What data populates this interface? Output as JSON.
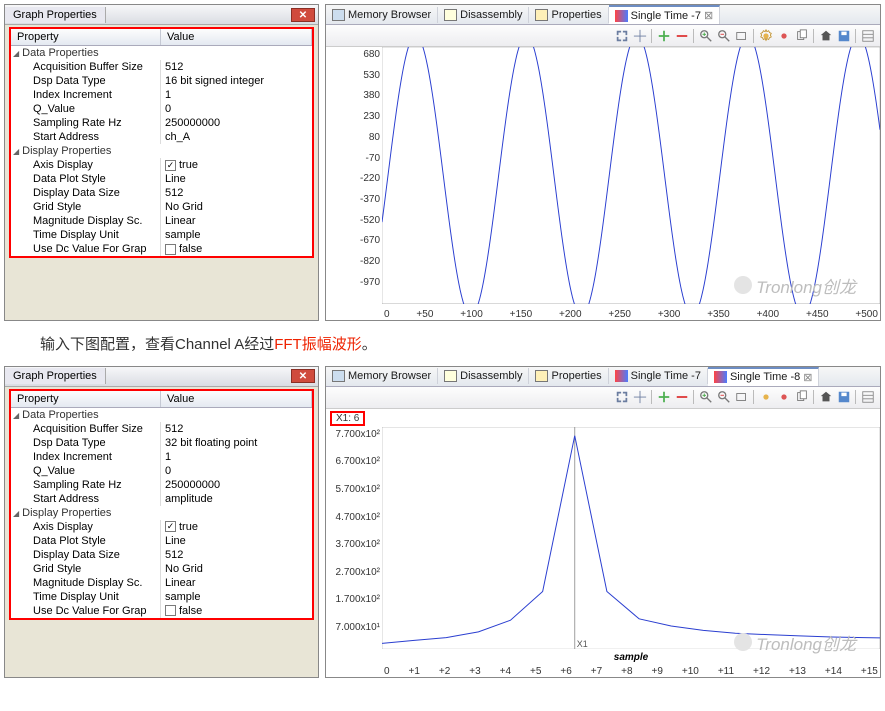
{
  "top_panel": {
    "window_title": "Graph Properties",
    "header": {
      "prop": "Property",
      "val": "Value"
    },
    "cat1": "Data Properties",
    "props1": [
      {
        "name": "Acquisition Buffer Size",
        "value": "512"
      },
      {
        "name": "Dsp Data Type",
        "value": "16 bit signed integer"
      },
      {
        "name": "Index Increment",
        "value": "1"
      },
      {
        "name": "Q_Value",
        "value": "0"
      },
      {
        "name": "Sampling Rate Hz",
        "value": "250000000"
      },
      {
        "name": "Start Address",
        "value": "ch_A"
      }
    ],
    "cat2": "Display Properties",
    "props2": [
      {
        "name": "Axis Display",
        "value": "true",
        "checkbox": true,
        "checked": true
      },
      {
        "name": "Data Plot Style",
        "value": "Line"
      },
      {
        "name": "Display Data Size",
        "value": "512"
      },
      {
        "name": "Grid Style",
        "value": "No Grid"
      },
      {
        "name": "Magnitude Display Sc.",
        "value": "Linear"
      },
      {
        "name": "Time Display Unit",
        "value": "sample"
      },
      {
        "name": "Use Dc Value For Grap",
        "value": "false",
        "checkbox": true,
        "checked": false
      }
    ]
  },
  "top_tabs": {
    "tabs": [
      {
        "label": "Memory Browser",
        "icon": "ico-mem"
      },
      {
        "label": "Disassembly",
        "icon": "ico-dis"
      },
      {
        "label": "Properties",
        "icon": "ico-prop"
      },
      {
        "label": "Single Time -7",
        "icon": "ico-chart",
        "active": true
      }
    ]
  },
  "bottom_tabs": {
    "tabs": [
      {
        "label": "Memory Browser",
        "icon": "ico-mem"
      },
      {
        "label": "Disassembly",
        "icon": "ico-dis"
      },
      {
        "label": "Properties",
        "icon": "ico-prop"
      },
      {
        "label": "Single Time -7",
        "icon": "ico-chart"
      },
      {
        "label": "Single Time -8",
        "icon": "ico-chart",
        "active": true
      }
    ]
  },
  "caption_pre": "输入下图配置，查看Channel A经过",
  "caption_hl": "FFT振幅波形",
  "caption_post": "。",
  "bottom_panel": {
    "window_title": "Graph Properties",
    "header": {
      "prop": "Property",
      "val": "Value"
    },
    "cat1": "Data Properties",
    "props1": [
      {
        "name": "Acquisition Buffer Size",
        "value": "512"
      },
      {
        "name": "Dsp Data Type",
        "value": "32 bit floating point"
      },
      {
        "name": "Index Increment",
        "value": "1"
      },
      {
        "name": "Q_Value",
        "value": "0"
      },
      {
        "name": "Sampling Rate Hz",
        "value": "250000000"
      },
      {
        "name": "Start Address",
        "value": "amplitude"
      }
    ],
    "cat2": "Display Properties",
    "props2": [
      {
        "name": "Axis Display",
        "value": "true",
        "checkbox": true,
        "checked": true
      },
      {
        "name": "Data Plot Style",
        "value": "Line"
      },
      {
        "name": "Display Data Size",
        "value": "512"
      },
      {
        "name": "Grid Style",
        "value": "No Grid"
      },
      {
        "name": "Magnitude Display Sc.",
        "value": "Linear"
      },
      {
        "name": "Time Display Unit",
        "value": "sample"
      },
      {
        "name": "Use Dc Value For Grap",
        "value": "false",
        "checkbox": true,
        "checked": false
      }
    ]
  },
  "bottom_marker": "X1: 6",
  "bottom_marker_label": "X1",
  "bottom_xlabel": "sample",
  "watermark": "Tronlong创龙",
  "chart_data": [
    {
      "type": "line",
      "title": "Single Time -7",
      "xlabel": "",
      "ylabel": "",
      "xlim": [
        0,
        510
      ],
      "ylim": [
        -970,
        680
      ],
      "x_ticks": [
        "0",
        "+50",
        "+100",
        "+150",
        "+200",
        "+250",
        "+300",
        "+350",
        "+400",
        "+450",
        "+500"
      ],
      "y_ticks": [
        680,
        530,
        380,
        230,
        80,
        -70,
        -220,
        -370,
        -520,
        -670,
        -820,
        -970
      ],
      "series": [
        {
          "name": "ch_A",
          "description": "~4.5 cycles sinusoid, amplitude about 900 centered near -145, starting near -300 falling"
        }
      ]
    },
    {
      "type": "line",
      "title": "Single Time -8",
      "xlabel": "sample",
      "ylabel": "amplitude",
      "xlim": [
        0,
        15.5
      ],
      "ylim": [
        0,
        770
      ],
      "x_ticks": [
        "0",
        "+1",
        "+2",
        "+3",
        "+4",
        "+5",
        "+6",
        "+7",
        "+8",
        "+9",
        "+10",
        "+11",
        "+12",
        "+13",
        "+14",
        "+15"
      ],
      "y_ticks_labels": [
        "7.700x10²",
        "6.700x10²",
        "5.700x10²",
        "4.700x10²",
        "3.700x10²",
        "2.700x10²",
        "1.700x10²",
        "7.000x10¹"
      ],
      "y_ticks": [
        770,
        670,
        570,
        470,
        370,
        270,
        170,
        70
      ],
      "marker": {
        "name": "X1",
        "x": 6
      },
      "series": [
        {
          "name": "amplitude",
          "x": [
            0,
            1,
            2,
            3,
            4,
            5,
            6,
            7,
            8,
            9,
            10,
            11,
            12,
            13,
            14,
            15,
            15.5
          ],
          "y": [
            20,
            30,
            40,
            60,
            100,
            200,
            740,
            200,
            105,
            80,
            65,
            55,
            50,
            46,
            42,
            40,
            39
          ]
        }
      ]
    }
  ]
}
